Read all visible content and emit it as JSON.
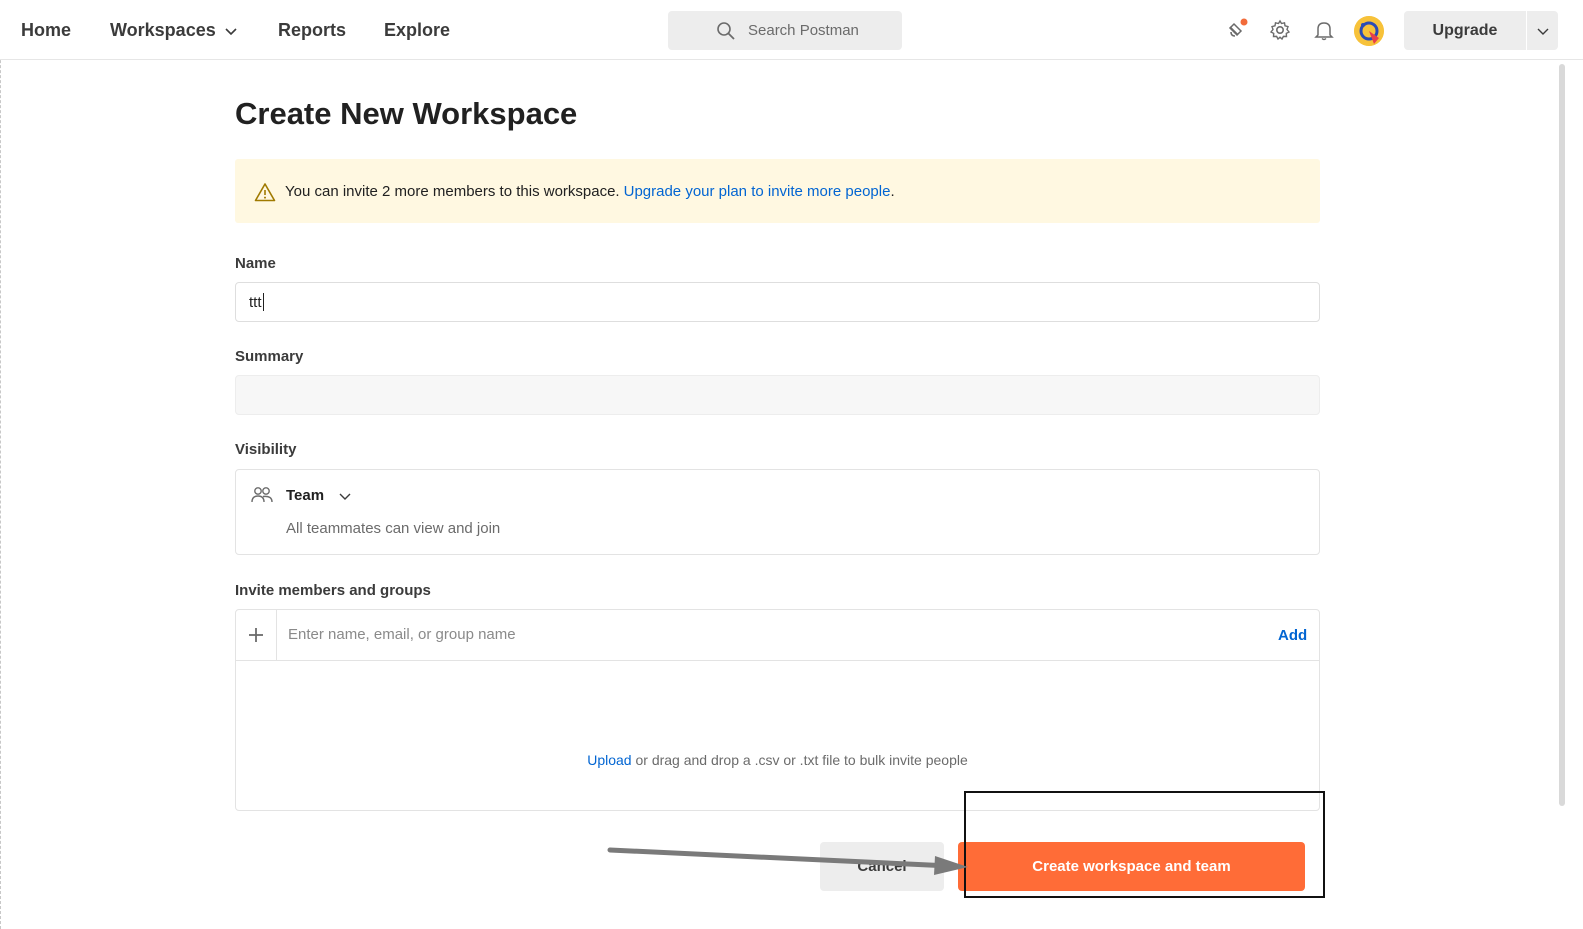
{
  "nav": {
    "home": "Home",
    "workspaces": "Workspaces",
    "reports": "Reports",
    "explore": "Explore"
  },
  "search": {
    "placeholder": "Search Postman"
  },
  "topbar": {
    "upgrade_label": "Upgrade",
    "icons": [
      "satellite-icon",
      "gear-icon",
      "bell-icon",
      "avatar"
    ],
    "notification_dot_color": "#f26b3a"
  },
  "page": {
    "title": "Create New Workspace",
    "alert": {
      "text": "You can invite 2 more members to this workspace.",
      "link": "Upgrade your plan to invite more people",
      "trailing": "."
    },
    "name": {
      "label": "Name",
      "value": "ttt"
    },
    "summary": {
      "label": "Summary",
      "value": ""
    },
    "visibility": {
      "label": "Visibility",
      "selected": "Team",
      "description": "All teammates can view and join"
    },
    "invite": {
      "label": "Invite members and groups",
      "placeholder": "Enter name, email, or group name",
      "add_label": "Add",
      "upload_link": "Upload",
      "upload_text": " or drag and drop a .csv or .txt file to bulk invite people"
    },
    "actions": {
      "cancel_label": "Cancel",
      "create_label": "Create workspace and team"
    }
  },
  "colors": {
    "accent": "#ff6c37",
    "link": "#0265d2",
    "alert_bg": "#fff8e1"
  }
}
